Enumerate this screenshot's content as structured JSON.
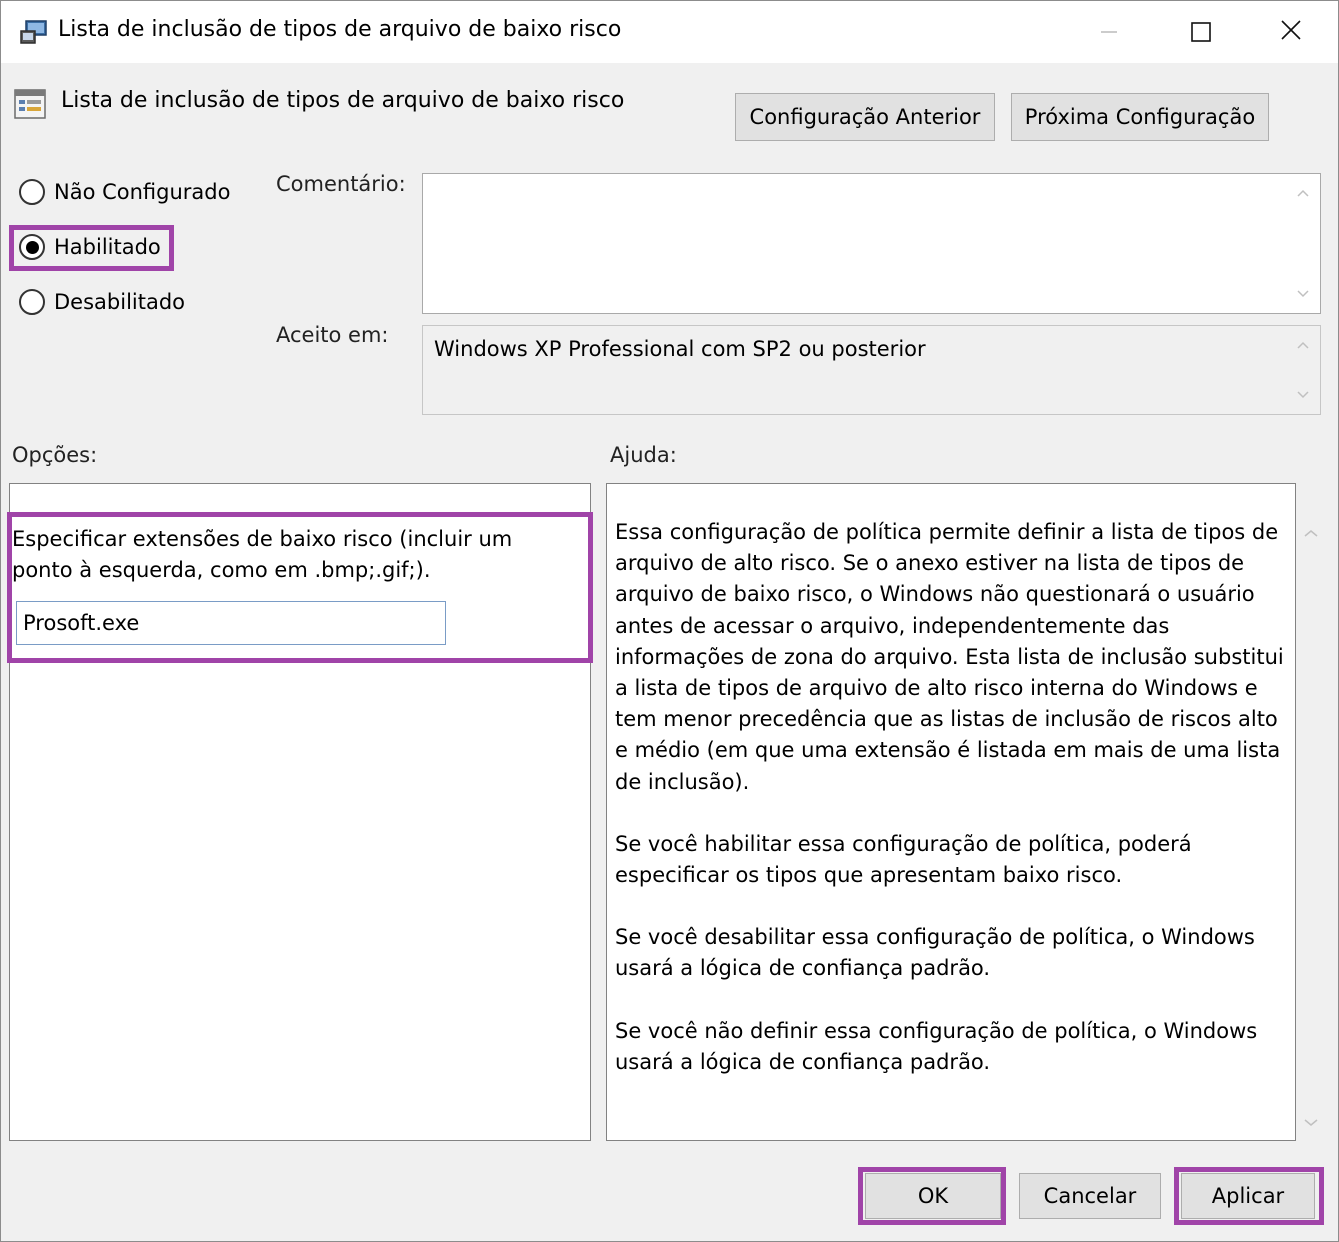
{
  "window": {
    "title": "Lista de inclusão de tipos de arquivo de baixo risco"
  },
  "header": {
    "policy_name": "Lista de inclusão de tipos de arquivo de baixo risco",
    "prev_button": "Configuração Anterior",
    "next_button": "Próxima Configuração"
  },
  "state": {
    "options": [
      "Não Configurado",
      "Habilitado",
      "Desabilitado"
    ],
    "selected": "Habilitado"
  },
  "comment": {
    "label": "Comentário:",
    "value": ""
  },
  "supported": {
    "label": "Aceito em:",
    "value": "Windows XP Professional com SP2 ou posterior"
  },
  "options": {
    "label": "Opções:",
    "description": "Especificar extensões de baixo risco (incluir um ponto à esquerda, como em .bmp;.gif;).",
    "input_value": "Prosoft.exe"
  },
  "help": {
    "label": "Ajuda:",
    "paragraphs": [
      "Essa configuração de política permite definir a lista de tipos de arquivo de alto risco. Se o anexo estiver na lista de tipos de arquivo de baixo risco, o Windows não questionará o usuário antes de acessar o arquivo, independentemente das informações de zona do arquivo. Esta lista de inclusão substitui a lista de tipos de arquivo de alto risco interna do Windows e tem menor precedência que as listas de inclusão de riscos alto e médio (em que uma extensão é listada em mais de uma lista de inclusão).",
      "Se você habilitar essa configuração de política, poderá especificar os tipos que apresentam baixo risco.",
      "Se você desabilitar essa configuração de política, o Windows usará a lógica de confiança padrão.",
      "Se você não definir essa configuração de política, o Windows usará a lógica de confiança padrão."
    ]
  },
  "footer": {
    "ok": "OK",
    "cancel": "Cancelar",
    "apply": "Aplicar"
  },
  "colors": {
    "highlight": "#a044a8",
    "dialog_bg": "#f0f0f0",
    "button_bg": "#e1e1e1"
  }
}
